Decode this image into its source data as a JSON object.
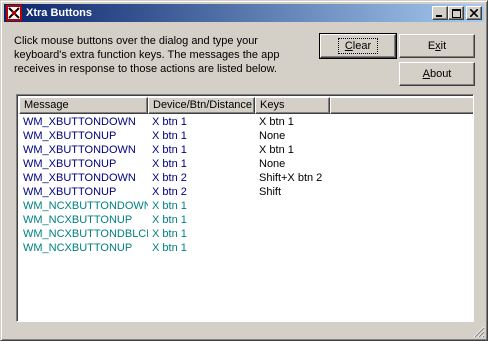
{
  "window": {
    "title": "Xtra Buttons",
    "icon": "app-icon",
    "controls": {
      "minimize": "minimize-icon",
      "maximize": "maximize-icon",
      "close": "close-icon"
    }
  },
  "description": {
    "line1": "Click mouse buttons over the dialog and type your",
    "line2": "keyboard's extra function keys. The messages the app",
    "line3": "receives in response to those actions are listed below."
  },
  "buttons": {
    "clear": {
      "hotkey": "C",
      "rest": "lear"
    },
    "exit": {
      "pre": "E",
      "hotkey": "x",
      "rest": "it"
    },
    "about": {
      "hotkey": "A",
      "rest": "bout"
    }
  },
  "list": {
    "columns": [
      "Message",
      "Device/Btn/Distance",
      "Keys"
    ],
    "rows": [
      [
        "WM_XBUTTONDOWN",
        "X btn 1",
        "X btn 1"
      ],
      [
        "WM_XBUTTONUP",
        "X btn 1",
        "None"
      ],
      [
        "WM_XBUTTONDOWN",
        "X btn 1",
        "X btn 1"
      ],
      [
        "WM_XBUTTONUP",
        "X btn 1",
        "None"
      ],
      [
        "WM_XBUTTONDOWN",
        "X btn 2",
        "Shift+X btn 2"
      ],
      [
        "WM_XBUTTONUP",
        "X btn 2",
        "Shift"
      ],
      [
        "WM_NCXBUTTONDOWN",
        "X btn 1",
        ""
      ],
      [
        "WM_NCXBUTTONUP",
        "X btn 1",
        ""
      ],
      [
        "WM_NCXBUTTONDBLCLK",
        "X btn 1",
        ""
      ],
      [
        "WM_NCXBUTTONUP",
        "X btn 1",
        ""
      ]
    ],
    "row_colors": [
      "#000080",
      "#000080",
      "#000080",
      "#000080",
      "#000080",
      "#000080",
      "#008080",
      "#008080",
      "#008080",
      "#008080"
    ],
    "key_color": "#000000"
  },
  "colors": {
    "titlebar_start": "#0a246a",
    "titlebar_end": "#a6caf0",
    "face": "#d4d0c8",
    "client_message_color": "#000080",
    "nonclient_message_color": "#008080"
  }
}
